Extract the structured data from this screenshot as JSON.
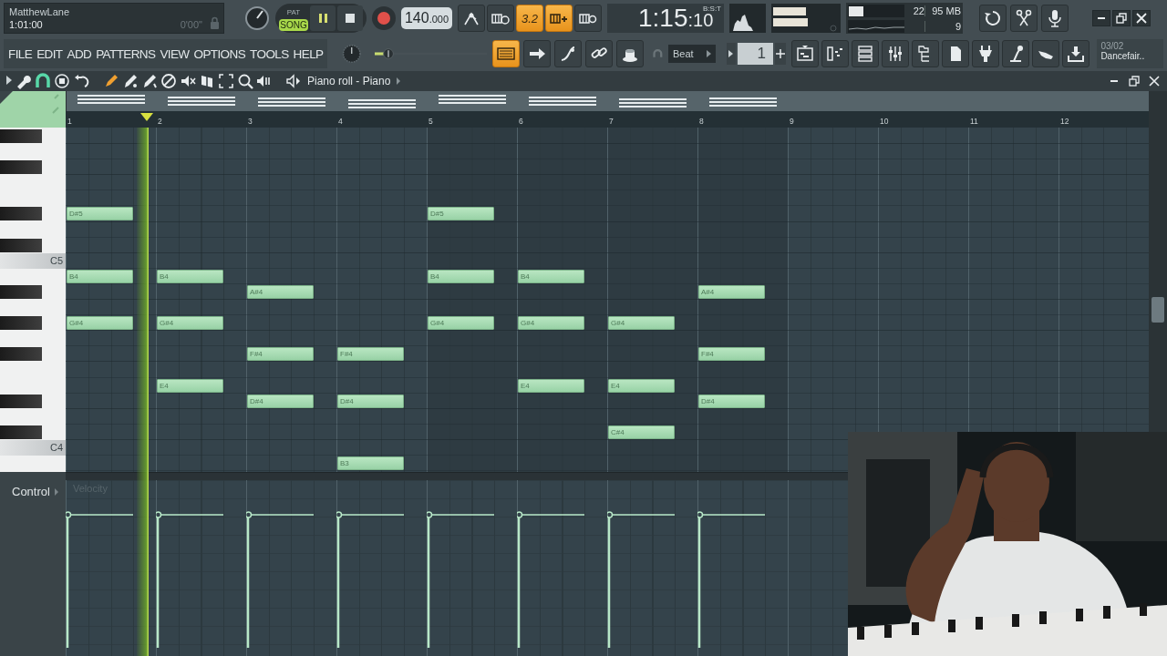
{
  "song_panel": {
    "title": "MatthewLane",
    "position": "1:01:00",
    "time": "0'00\""
  },
  "transport": {
    "modes": [
      {
        "label": "PAT",
        "selected": false
      },
      {
        "label": "SONG",
        "selected": true
      }
    ]
  },
  "tempo": {
    "whole": "140",
    "fraction": ".000"
  },
  "top_toggles": [
    {
      "on": false
    },
    {
      "on": false
    },
    {
      "on": true,
      "label": "3.2"
    },
    {
      "on": true
    },
    {
      "on": false
    }
  ],
  "clock": {
    "main": "1:15",
    "sub": ":10",
    "unit": "B:S:T"
  },
  "monitor": {
    "polyphony": "22",
    "memory": "95 MB",
    "readout_3": "9"
  },
  "menu": [
    "FILE",
    "EDIT",
    "ADD",
    "PATTERNS",
    "VIEW",
    "OPTIONS",
    "TOOLS",
    "HELP"
  ],
  "master_slider": {
    "level": 0.08
  },
  "tool_toggles": [
    {
      "on": true
    },
    {
      "on": false
    },
    {
      "on": false
    },
    {
      "on": false
    },
    {
      "on": false
    }
  ],
  "snap": "Beat",
  "pattern": "1",
  "hint": {
    "line_1": "03/02",
    "line_2": "Dancefair.."
  },
  "piano_roll": {
    "title": "Piano roll - Piano",
    "bar_numbers": [
      "1",
      "2",
      "3",
      "4",
      "5",
      "6",
      "7",
      "8",
      "9",
      "10",
      "11",
      "12"
    ],
    "rows": [
      {
        "kind": "black"
      },
      {
        "kind": "white"
      },
      {
        "kind": "black"
      },
      {
        "kind": "white"
      },
      {
        "kind": "white"
      },
      {
        "kind": "black",
        "cells": [
          {
            "kind": "note",
            "label": "D#5"
          },
          {
            "kind": "rest"
          },
          {
            "kind": "rest"
          },
          {
            "kind": "rest"
          },
          {
            "kind": "note",
            "label": "D#5"
          }
        ]
      },
      {
        "kind": "white"
      },
      {
        "kind": "black"
      },
      {
        "kind": "white",
        "label": "C5"
      },
      {
        "kind": "white",
        "cells": [
          {
            "kind": "note",
            "label": "B4"
          },
          {
            "kind": "note",
            "label": "B4"
          },
          {
            "kind": "rest"
          },
          {
            "kind": "rest"
          },
          {
            "kind": "note",
            "label": "B4"
          },
          {
            "kind": "note",
            "label": "B4"
          }
        ]
      },
      {
        "kind": "black",
        "cells": [
          {
            "kind": "rest"
          },
          {
            "kind": "rest"
          },
          {
            "kind": "note",
            "label": "A#4"
          },
          {
            "kind": "rest"
          },
          {
            "kind": "rest"
          },
          {
            "kind": "rest"
          },
          {
            "kind": "rest"
          },
          {
            "kind": "note",
            "label": "A#4"
          }
        ]
      },
      {
        "kind": "white"
      },
      {
        "kind": "black",
        "cells": [
          {
            "kind": "note",
            "label": "G#4"
          },
          {
            "kind": "note",
            "label": "G#4"
          },
          {
            "kind": "rest"
          },
          {
            "kind": "rest"
          },
          {
            "kind": "note",
            "label": "G#4"
          },
          {
            "kind": "note",
            "label": "G#4"
          },
          {
            "kind": "note",
            "label": "G#4"
          }
        ]
      },
      {
        "kind": "white"
      },
      {
        "kind": "black",
        "cells": [
          {
            "kind": "rest"
          },
          {
            "kind": "rest"
          },
          {
            "kind": "note",
            "label": "F#4"
          },
          {
            "kind": "note",
            "label": "F#4"
          },
          {
            "kind": "rest"
          },
          {
            "kind": "rest"
          },
          {
            "kind": "rest"
          },
          {
            "kind": "note",
            "label": "F#4"
          }
        ]
      },
      {
        "kind": "white"
      },
      {
        "kind": "white",
        "cells": [
          {
            "kind": "rest"
          },
          {
            "kind": "note",
            "label": "E4"
          },
          {
            "kind": "rest"
          },
          {
            "kind": "rest"
          },
          {
            "kind": "rest"
          },
          {
            "kind": "note",
            "label": "E4"
          },
          {
            "kind": "note",
            "label": "E4"
          }
        ]
      },
      {
        "kind": "black",
        "cells": [
          {
            "kind": "rest"
          },
          {
            "kind": "rest"
          },
          {
            "kind": "note",
            "label": "D#4"
          },
          {
            "kind": "note",
            "label": "D#4"
          },
          {
            "kind": "rest"
          },
          {
            "kind": "rest"
          },
          {
            "kind": "rest"
          },
          {
            "kind": "note",
            "label": "D#4"
          }
        ]
      },
      {
        "kind": "white"
      },
      {
        "kind": "black",
        "cells": [
          {
            "kind": "rest"
          },
          {
            "kind": "rest"
          },
          {
            "kind": "rest"
          },
          {
            "kind": "rest"
          },
          {
            "kind": "rest"
          },
          {
            "kind": "rest"
          },
          {
            "kind": "note",
            "label": "C#4"
          }
        ]
      },
      {
        "kind": "white",
        "label": "C4"
      },
      {
        "kind": "white",
        "cells": [
          {
            "kind": "rest"
          },
          {
            "kind": "rest"
          },
          {
            "kind": "rest"
          },
          {
            "kind": "note",
            "label": "B3"
          }
        ]
      }
    ],
    "control": {
      "label": "Control",
      "parameter": "Velocity"
    }
  }
}
